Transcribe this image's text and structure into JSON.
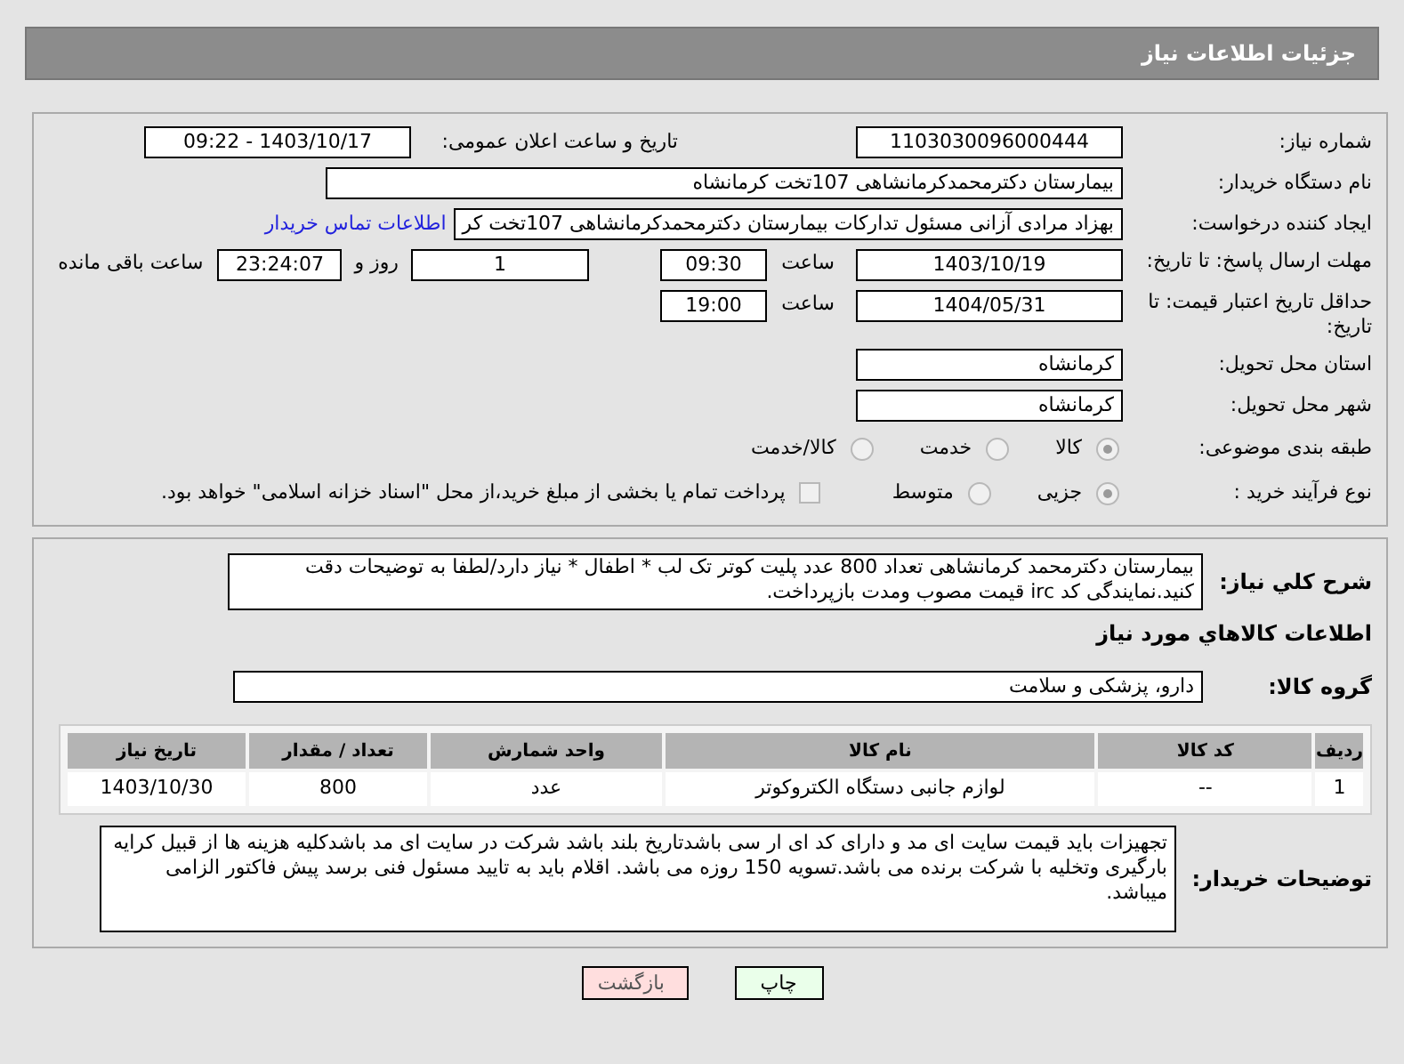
{
  "header": {
    "title": "جزئیات اطلاعات نیاز"
  },
  "need_number": {
    "label": "شماره نیاز:",
    "value": "1103030096000444"
  },
  "announce": {
    "label": "تاریخ و ساعت اعلان عمومی:",
    "value": "1403/10/17 - 09:22"
  },
  "buyer_org": {
    "label": "نام دستگاه خریدار:",
    "value": "بیمارستان دکترمحمدکرمانشاهی 107تخت کرمانشاه"
  },
  "requester": {
    "label": "ایجاد کننده درخواست:",
    "value": "بهزاد مرادی آزانی مسئول تدارکات بیمارستان دکترمحمدکرمانشاهی 107تخت کر",
    "link": "اطلاعات تماس خریدار"
  },
  "deadline": {
    "label": "مهلت ارسال پاسخ: تا تاریخ:",
    "date": "1403/10/19",
    "time_label": "ساعت",
    "time": "09:30",
    "days": "1",
    "days_label": "روز و",
    "remaining": "23:24:07",
    "remaining_label": "ساعت باقی مانده"
  },
  "validity": {
    "label": "حداقل تاریخ اعتبار قیمت: تا تاریخ:",
    "date": "1404/05/31",
    "time_label": "ساعت",
    "time": "19:00"
  },
  "province": {
    "label": "استان محل تحویل:",
    "value": "کرمانشاه"
  },
  "city": {
    "label": "شهر محل تحویل:",
    "value": "کرمانشاه"
  },
  "category": {
    "label": "طبقه بندی موضوعی:",
    "options": [
      {
        "label": "کالا",
        "selected": true
      },
      {
        "label": "خدمت",
        "selected": false
      },
      {
        "label": "کالا/خدمت",
        "selected": false
      }
    ]
  },
  "process": {
    "label": "نوع فرآیند خرید :",
    "options": [
      {
        "label": "جزیی",
        "selected": true
      },
      {
        "label": "متوسط",
        "selected": false
      }
    ],
    "treasury": {
      "label": "پرداخت تمام یا بخشی از مبلغ خرید،از محل \"اسناد خزانه اسلامی\" خواهد بود.",
      "checked": false
    }
  },
  "description": {
    "label": "شرح کلي نياز:",
    "value": "بیمارستان دکترمحمد کرمانشاهی تعداد 800 عدد پلیت کوتر تک لب * اطفال * نیاز دارد/لطفا به توضیحات دقت کنید.نمایندگی کد irc قیمت مصوب ومدت بازپرداخت."
  },
  "goods_title": "اطلاعات کالاهاي مورد نياز",
  "goods_group": {
    "label": "گروه کالا:",
    "value": "دارو، پزشکی و سلامت"
  },
  "table": {
    "columns": [
      "ردیف",
      "کد کالا",
      "نام کالا",
      "واحد شمارش",
      "تعداد / مقدار",
      "تاریخ نیاز"
    ],
    "rows": [
      [
        "1",
        "--",
        "لوازم جانبی دستگاه الکتروکوتر",
        "عدد",
        "800",
        "1403/10/30"
      ]
    ]
  },
  "buyer_notes": {
    "label": "توضیحات خریدار:",
    "value": "تجهیزات باید قیمت سایت ای مد و دارای کد ای ار سی باشدتاریخ بلند باشد شرکت در سایت ای مد باشدکلیه هزینه ها از قبیل کرایه بارگیری وتخلیه با شرکت برنده می باشد.تسویه 150 روزه می باشد. اقلام باید به تایید مسئول فنی برسد پیش فاکتور الزامی میباشد."
  },
  "buttons": [
    {
      "kind": "print",
      "label": "چاپ"
    },
    {
      "kind": "back",
      "label": "بازگشت"
    }
  ]
}
